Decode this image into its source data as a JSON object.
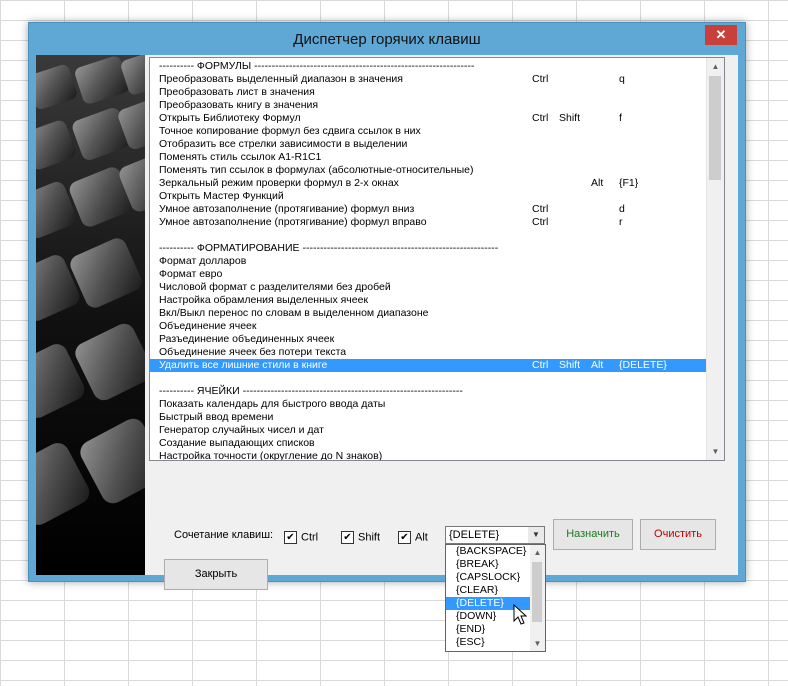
{
  "window": {
    "title": "Диспетчер горячих клавиш",
    "close_label": "✕"
  },
  "shortcuts": [
    {
      "desc": "---------- ФОРМУЛЫ ---------------------------------------------------------------",
      "k1": "",
      "k2": "",
      "k3": "",
      "k4": ""
    },
    {
      "desc": "Преобразовать выделенный диапазон в значения",
      "k1": "Ctrl",
      "k2": "",
      "k3": "",
      "k4": "q"
    },
    {
      "desc": "Преобразовать лист в значения",
      "k1": "",
      "k2": "",
      "k3": "",
      "k4": ""
    },
    {
      "desc": "Преобразовать книгу в значения",
      "k1": "",
      "k2": "",
      "k3": "",
      "k4": ""
    },
    {
      "desc": "Открыть Библиотеку Формул",
      "k1": "Ctrl",
      "k2": "Shift",
      "k3": "",
      "k4": "f"
    },
    {
      "desc": "Точное копирование формул без сдвига ссылок в них",
      "k1": "",
      "k2": "",
      "k3": "",
      "k4": ""
    },
    {
      "desc": "Отобразить все стрелки зависимости в выделении",
      "k1": "",
      "k2": "",
      "k3": "",
      "k4": ""
    },
    {
      "desc": "Поменять стиль ссылок А1-R1C1",
      "k1": "",
      "k2": "",
      "k3": "",
      "k4": ""
    },
    {
      "desc": "Поменять тип ссылок в формулах (абсолютные-относительные)",
      "k1": "",
      "k2": "",
      "k3": "",
      "k4": ""
    },
    {
      "desc": "Зеркальный режим проверки формул в 2-х окнах",
      "k1": "",
      "k2": "",
      "k3": "Alt",
      "k4": "{F1}"
    },
    {
      "desc": "Открыть Мастер Функций",
      "k1": "",
      "k2": "",
      "k3": "",
      "k4": ""
    },
    {
      "desc": "Умное автозаполнение (протягивание) формул вниз",
      "k1": "Ctrl",
      "k2": "",
      "k3": "",
      "k4": "d"
    },
    {
      "desc": "Умное автозаполнение (протягивание) формул вправо",
      "k1": "Ctrl",
      "k2": "",
      "k3": "",
      "k4": "r"
    },
    {
      "desc": "",
      "k1": "",
      "k2": "",
      "k3": "",
      "k4": ""
    },
    {
      "desc": "---------- ФОРМАТИРОВАНИЕ --------------------------------------------------------",
      "k1": "",
      "k2": "",
      "k3": "",
      "k4": ""
    },
    {
      "desc": "Формат долларов",
      "k1": "",
      "k2": "",
      "k3": "",
      "k4": ""
    },
    {
      "desc": "Формат евро",
      "k1": "",
      "k2": "",
      "k3": "",
      "k4": ""
    },
    {
      "desc": "Числовой формат с разделителями без дробей",
      "k1": "",
      "k2": "",
      "k3": "",
      "k4": ""
    },
    {
      "desc": "Настройка обрамления выделенных ячеек",
      "k1": "",
      "k2": "",
      "k3": "",
      "k4": ""
    },
    {
      "desc": "Вкл/Выкл перенос по словам в выделенном диапазоне",
      "k1": "",
      "k2": "",
      "k3": "",
      "k4": ""
    },
    {
      "desc": "Объединение ячеек",
      "k1": "",
      "k2": "",
      "k3": "",
      "k4": ""
    },
    {
      "desc": "Разъединение объединенных ячеек",
      "k1": "",
      "k2": "",
      "k3": "",
      "k4": ""
    },
    {
      "desc": "Объединение ячеек без потери текста",
      "k1": "",
      "k2": "",
      "k3": "",
      "k4": ""
    },
    {
      "desc": "Удалить все лишние стили в книге",
      "k1": "Ctrl",
      "k2": "Shift",
      "k3": "Alt",
      "k4": "{DELETE}",
      "selected": true
    },
    {
      "desc": "",
      "k1": "",
      "k2": "",
      "k3": "",
      "k4": ""
    },
    {
      "desc": "---------- ЯЧЕЙКИ ---------------------------------------------------------------",
      "k1": "",
      "k2": "",
      "k3": "",
      "k4": ""
    },
    {
      "desc": "Показать календарь для быстрого ввода даты",
      "k1": "",
      "k2": "",
      "k3": "",
      "k4": ""
    },
    {
      "desc": "Быстрый ввод времени",
      "k1": "",
      "k2": "",
      "k3": "",
      "k4": ""
    },
    {
      "desc": "Генератор случайных чисел и дат",
      "k1": "",
      "k2": "",
      "k3": "",
      "k4": ""
    },
    {
      "desc": "Создание выпадающих списков",
      "k1": "",
      "k2": "",
      "k3": "",
      "k4": ""
    },
    {
      "desc": "Настройка точности (округление до N знаков)",
      "k1": "",
      "k2": "",
      "k3": "",
      "k4": ""
    }
  ],
  "controls": {
    "combo_label": "Сочетание клавиш:",
    "ctrl_label": "Ctrl",
    "shift_label": "Shift",
    "alt_label": "Alt",
    "ctrl_checked": true,
    "shift_checked": true,
    "alt_checked": true,
    "key_value": "{DELETE}",
    "assign_label": "Назначить",
    "clear_label": "Очистить",
    "close_label": "Закрыть"
  },
  "key_options": [
    "{BACKSPACE}",
    "{BREAK}",
    "{CAPSLOCK}",
    "{CLEAR}",
    "{DELETE}",
    "{DOWN}",
    "{END}",
    "{ESC}"
  ],
  "key_selected_index": 4,
  "colors": {
    "window_frame": "#5fa7d4",
    "selection": "#3399ff",
    "assign_text": "#1a7a1a",
    "clear_text": "#c00000"
  }
}
